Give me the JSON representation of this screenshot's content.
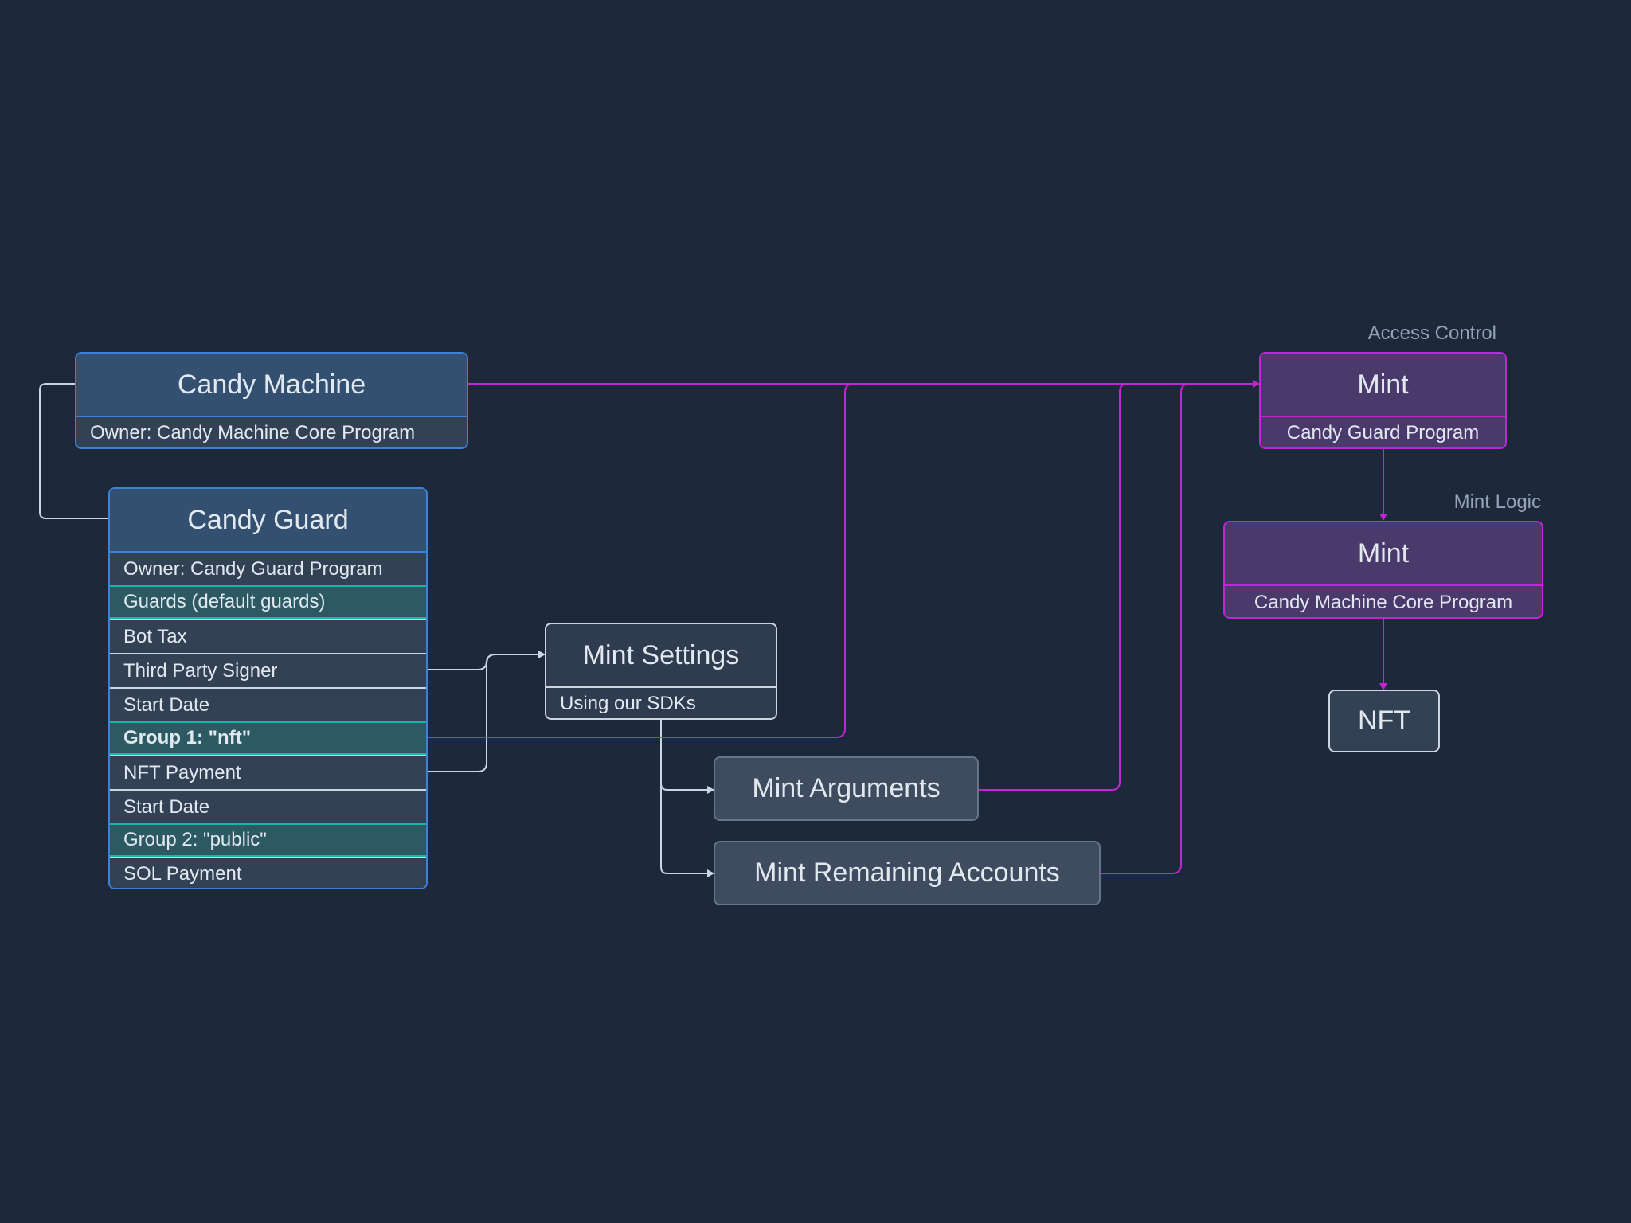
{
  "candy_machine": {
    "title": "Candy Machine",
    "owner": "Owner: Candy Machine Core Program"
  },
  "candy_guard": {
    "title": "Candy Guard",
    "rows": [
      {
        "label": "Owner: Candy Guard Program",
        "style": "plain"
      },
      {
        "label": "Guards (default guards)",
        "style": "group"
      },
      {
        "label": "Bot Tax",
        "style": "plain"
      },
      {
        "label": "Third Party Signer",
        "style": "plain"
      },
      {
        "label": "Start Date",
        "style": "plain"
      },
      {
        "label": "Group 1: \"nft\"",
        "style": "group-bold"
      },
      {
        "label": "NFT Payment",
        "style": "plain"
      },
      {
        "label": "Start Date",
        "style": "plain"
      },
      {
        "label": "Group 2: \"public\"",
        "style": "group"
      },
      {
        "label": "SOL Payment",
        "style": "plain"
      }
    ]
  },
  "mint_settings": {
    "title": "Mint Settings",
    "subtitle": "Using our SDKs"
  },
  "mint_arguments": {
    "title": "Mint Arguments"
  },
  "mint_remaining_accounts": {
    "title": "Mint Remaining Accounts"
  },
  "access_control": {
    "label": "Access Control",
    "title": "Mint",
    "program": "Candy Guard Program"
  },
  "mint_logic": {
    "label": "Mint Logic",
    "title": "Mint",
    "program": "Candy Machine Core Program"
  },
  "nft": {
    "title": "NFT"
  },
  "colors": {
    "background": "#1e283b",
    "gray_line": "#cbd5e1",
    "purple_line": "#c026d3",
    "blue_border": "#3b82d6",
    "teal_border": "#14b8a6"
  }
}
